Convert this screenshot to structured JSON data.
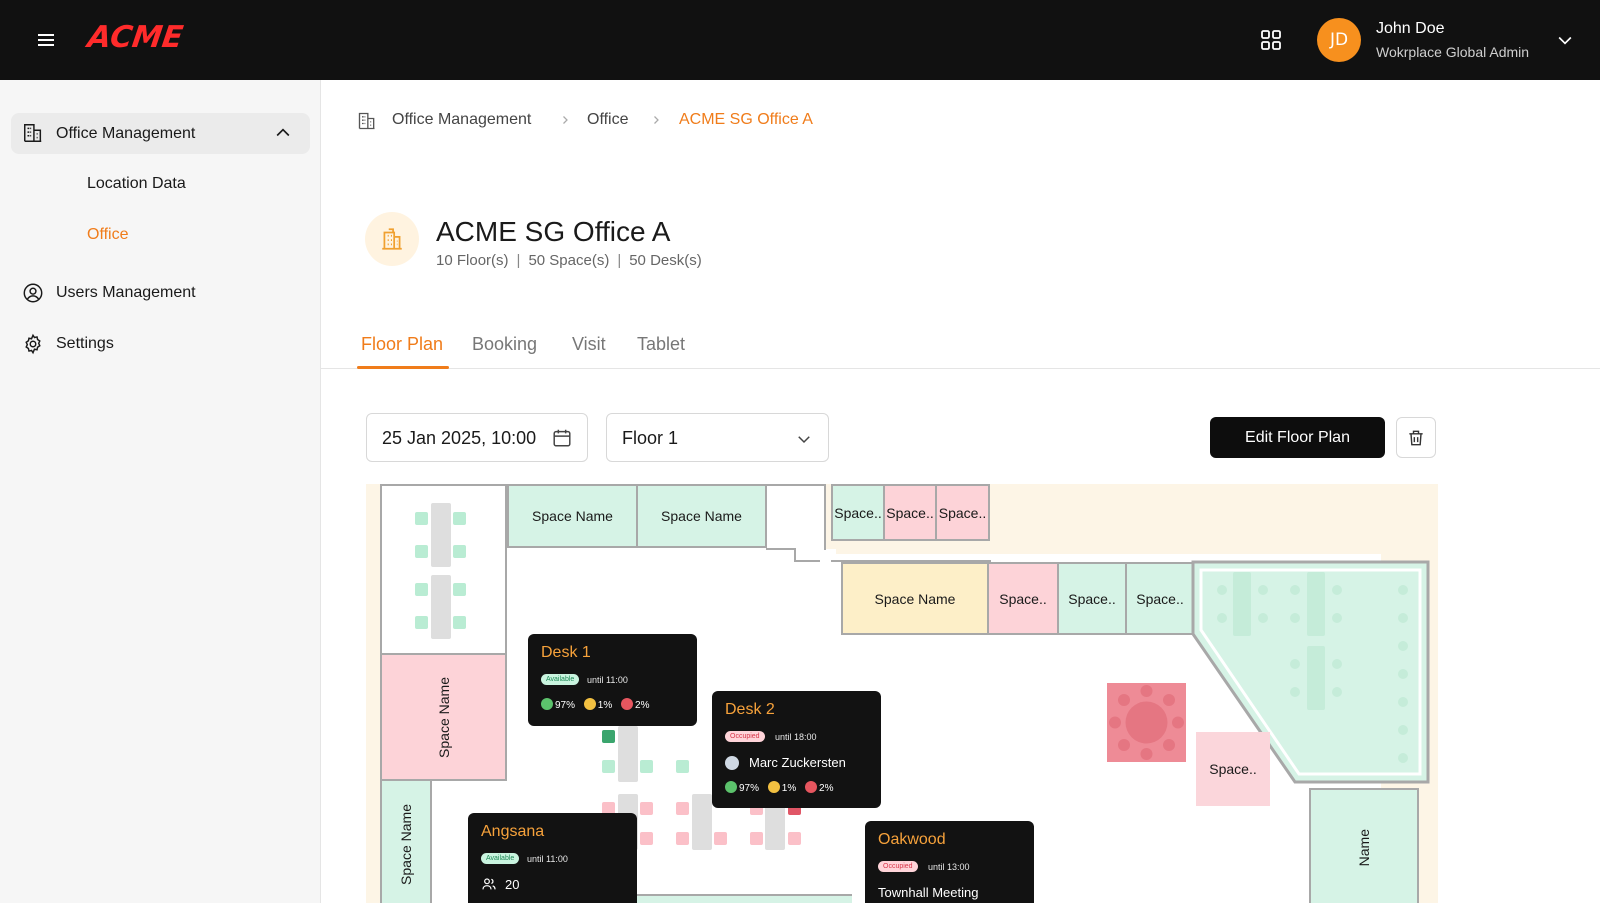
{
  "header": {
    "logo": "ACME",
    "user": {
      "initials": "JD",
      "name": "John Doe",
      "role": "Wokrplace Global Admin"
    }
  },
  "sidebar": {
    "group_label": "Office Management",
    "sub_items": [
      {
        "label": "Location Data"
      },
      {
        "label": "Office"
      }
    ],
    "items": [
      {
        "label": "Users Management"
      },
      {
        "label": "Settings"
      }
    ]
  },
  "breadcrumb": [
    "Office Management",
    "Office",
    "ACME SG Office A"
  ],
  "office": {
    "title": "ACME SG Office A",
    "floors": "10 Floor(s)",
    "spaces": "50 Space(s)",
    "desks": "50 Desk(s)"
  },
  "tabs": [
    {
      "label": "Floor Plan",
      "active": true
    },
    {
      "label": "Booking"
    },
    {
      "label": "Visit"
    },
    {
      "label": "Tablet"
    }
  ],
  "controls": {
    "datetime": "25 Jan 2025, 10:00",
    "floor": "Floor 1",
    "edit_label": "Edit Floor Plan"
  },
  "floorplan": {
    "rooms": {
      "r1": "Space Name",
      "r2": "Space Name",
      "r3": "Space..",
      "r4": "Space..",
      "r5": "Space..",
      "r6": "Space Name",
      "r7": "Space..",
      "r8": "Space..",
      "r9": "Space..",
      "r10": "Space Name",
      "r11": "Space Name",
      "r12": "Space..",
      "r13": "Name"
    },
    "popups": {
      "desk1": {
        "title": "Desk 1",
        "status": "Available",
        "until": "until 11:00",
        "happy": "97%",
        "neutral": "1%",
        "sad": "2%"
      },
      "desk2": {
        "title": "Desk 2",
        "status": "Occupied",
        "until": "until 18:00",
        "person": "Marc Zuckersten",
        "happy": "97%",
        "neutral": "1%",
        "sad": "2%"
      },
      "angsana": {
        "title": "Angsana",
        "status": "Available",
        "until": "until 11:00",
        "capacity": "20"
      },
      "oakwood": {
        "title": "Oakwood",
        "status": "Occupied",
        "until": "until 13:00",
        "event": "Townhall Meeting"
      }
    }
  },
  "colors": {
    "accent": "#f07c1a",
    "logo": "#ff2b2b",
    "avatar": "#f7901e",
    "space_available": "#d6f3e6",
    "space_occupied": "#fdd3d8",
    "space_reserved": "#fdefc8"
  }
}
